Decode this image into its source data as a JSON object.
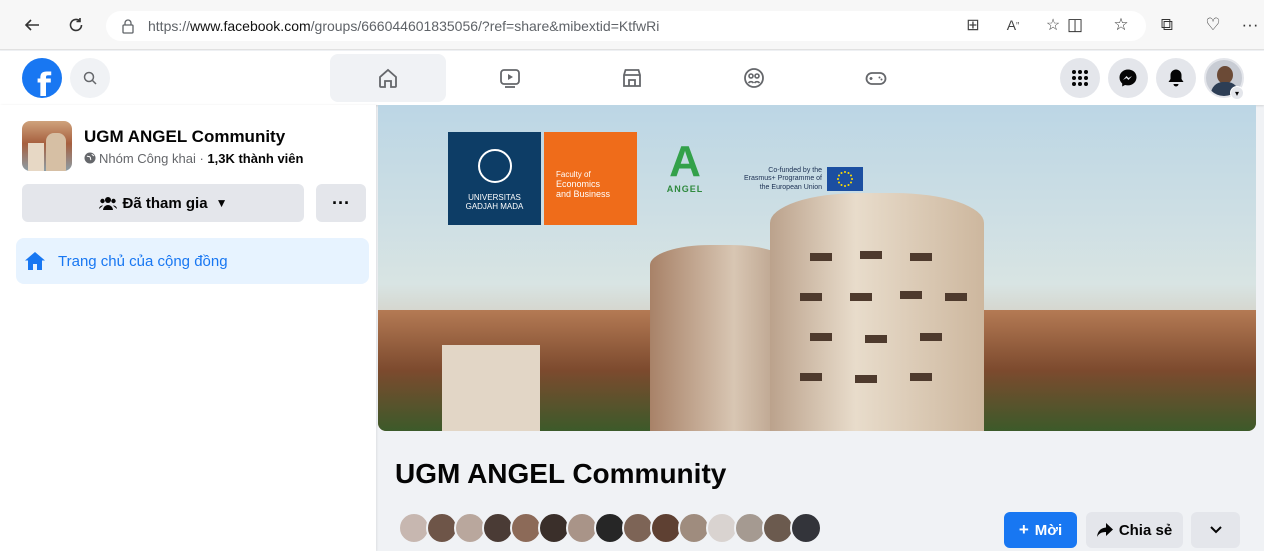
{
  "browser": {
    "url_prefix": "https://",
    "url_host": "www.facebook.com",
    "url_path": "/groups/666044601835056/?ref=share&mibextid=KtfwRi",
    "nav_icons": [
      "back-icon",
      "refresh-icon"
    ],
    "address_icons": [
      "app-available-icon",
      "read-aloud-icon",
      "favorite-star-icon"
    ],
    "toolbar_icons": [
      "split-screen-icon",
      "favorites-icon",
      "collections-icon",
      "browser-essentials-icon",
      "more-icon"
    ]
  },
  "fb_header": {
    "logo_letter": "f",
    "nav_tabs": [
      "home-icon",
      "video-icon",
      "marketplace-icon",
      "groups-icon",
      "gaming-icon"
    ],
    "active_tab": "home-icon",
    "right_icons": [
      "menu-grid-icon",
      "messenger-icon",
      "notifications-icon",
      "profile-avatar"
    ],
    "accent_color": "#1877f2"
  },
  "sidebar": {
    "group_name": "UGM ANGEL Community",
    "privacy_text": "Nhóm Công khai · ",
    "members_count": "1,3K thành viên",
    "joined_label": "Đã tham gia",
    "more_label": "···",
    "nav_item_label": "Trang chủ của cộng đồng"
  },
  "cover": {
    "ugm_line1": "UNIVERSITAS",
    "ugm_line2": "GADJAH MADA",
    "feb_line1": "Faculty of",
    "feb_line2": "Economics",
    "feb_line3": "and Business",
    "angel_letter": "A",
    "angel_word": "ANGEL",
    "eu_text": "Co-funded by the Erasmus+ Programme of the European Union"
  },
  "main": {
    "title": "UGM ANGEL Community",
    "member_avatars_count": 15,
    "invite_label": "Mời",
    "invite_prefix": "+",
    "share_label": "Chia sẻ"
  }
}
